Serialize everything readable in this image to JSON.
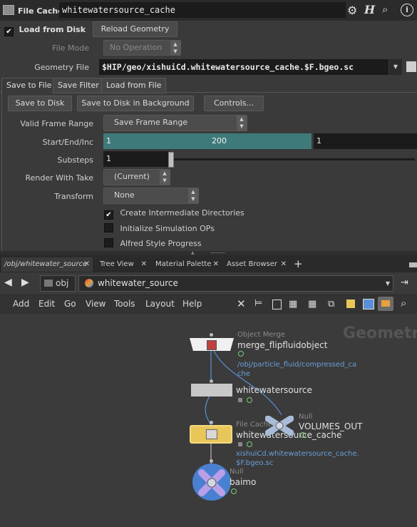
{
  "header": {
    "node_type": "File Cache",
    "node_name": "whitewatersource_cache"
  },
  "params": {
    "load_from_disk": "Load from Disk",
    "reload_geometry": "Reload Geometry",
    "file_mode_label": "File Mode",
    "file_mode_value": "No Operation",
    "geometry_file_label": "Geometry File",
    "geometry_file_value": "$HIP/geo/xishuiCd.whitewatersource_cache.$F.bgeo.sc",
    "tabs": [
      "Save to File",
      "Save Filter",
      "Load from File"
    ],
    "save_to_disk": "Save to Disk",
    "save_to_disk_bg": "Save to Disk in Background",
    "controls": "Controls...",
    "valid_frame_range_label": "Valid Frame Range",
    "valid_frame_range_value": "Save Frame Range",
    "start_end_inc_label": "Start/End/Inc",
    "start": "1",
    "end": "200",
    "inc": "1",
    "substeps_label": "Substeps",
    "substeps_value": "1",
    "render_with_take_label": "Render With Take",
    "render_with_take_value": "(Current)",
    "transform_label": "Transform",
    "transform_value": "None",
    "create_dirs": "Create Intermediate Directories",
    "init_sim_ops": "Initialize Simulation OPs",
    "alfred": "Alfred Style Progress"
  },
  "pane_tabs": [
    "/obj/whitewater_source",
    "Tree View",
    "Material Palette",
    "Asset Browser"
  ],
  "path": {
    "obj": "obj",
    "current": "whitewater_source"
  },
  "menu": [
    "Add",
    "Edit",
    "Go",
    "View",
    "Tools",
    "Layout",
    "Help"
  ],
  "network_watermark": "Geometry",
  "nodes": {
    "merge": {
      "type": "Object Merge",
      "name": "merge_flipfluidobject",
      "info": "/obj/particle_fluid/compressed_ca che"
    },
    "whitewatersource": {
      "name": "whitewatersource"
    },
    "volumes_out": {
      "type": "Null",
      "name": "VOLUMES_OUT"
    },
    "filecache": {
      "type": "File Cache",
      "name": "whitewatersource_cache",
      "info": "xishuiCd.whitewatersource_cache. $F.bgeo.sc"
    },
    "baimo": {
      "type": "Null",
      "name": "baimo"
    }
  },
  "colors": {
    "teal_field": "#3f7a7a",
    "node_yellow": "#e8c65a",
    "null_blue": "#5a8fd8",
    "link_blue": "#6a9fd8"
  }
}
